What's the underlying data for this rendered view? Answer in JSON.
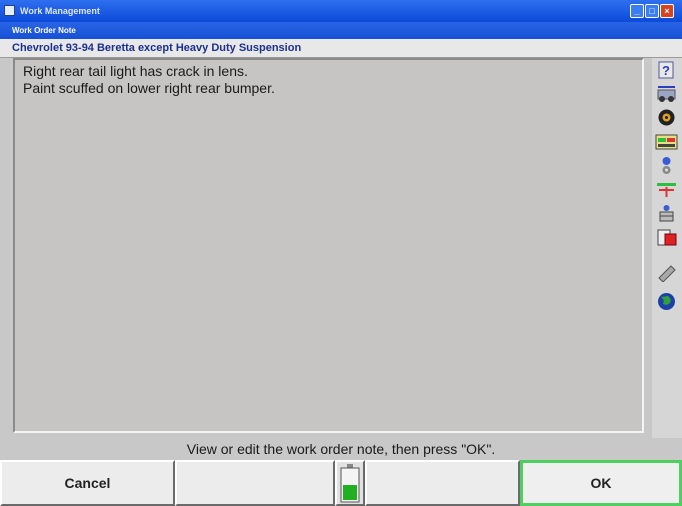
{
  "window": {
    "title": "Work Management",
    "minimize": "_",
    "maximize": "□",
    "close": "×"
  },
  "dialog": {
    "title": "Work Order Note"
  },
  "vehicle": {
    "label": "Chevrolet 93-94 Beretta except Heavy Duty Suspension"
  },
  "note": {
    "lines": [
      "Right rear tail light has crack in lens.",
      "Paint scuffed on lower right rear bumper."
    ],
    "text": "Right rear tail light has crack in lens.\nPaint scuffed on lower right rear bumper."
  },
  "toolbar": {
    "items": [
      {
        "icon": "help-icon"
      },
      {
        "icon": "vehicle-specs-icon"
      },
      {
        "icon": "wheel-icon"
      },
      {
        "icon": "alignment-meter-icon"
      },
      {
        "icon": "sensor-icon"
      },
      {
        "icon": "adjust-icon"
      },
      {
        "icon": "measurement-icon"
      },
      {
        "icon": "report-icon"
      },
      {
        "icon": "note-icon"
      },
      {
        "icon": "globe-icon"
      }
    ]
  },
  "instruction": "View or edit the work order note, then press \"OK\".",
  "softkeys": {
    "cancel": "Cancel",
    "blank1": "",
    "blank2": "",
    "ok": "OK"
  },
  "level_indicator": {
    "value": 0.5
  },
  "colors": {
    "title_bar": "#0b49d8",
    "vehicle_text": "#1b2f8f",
    "ok_border": "#4fcf5f"
  }
}
